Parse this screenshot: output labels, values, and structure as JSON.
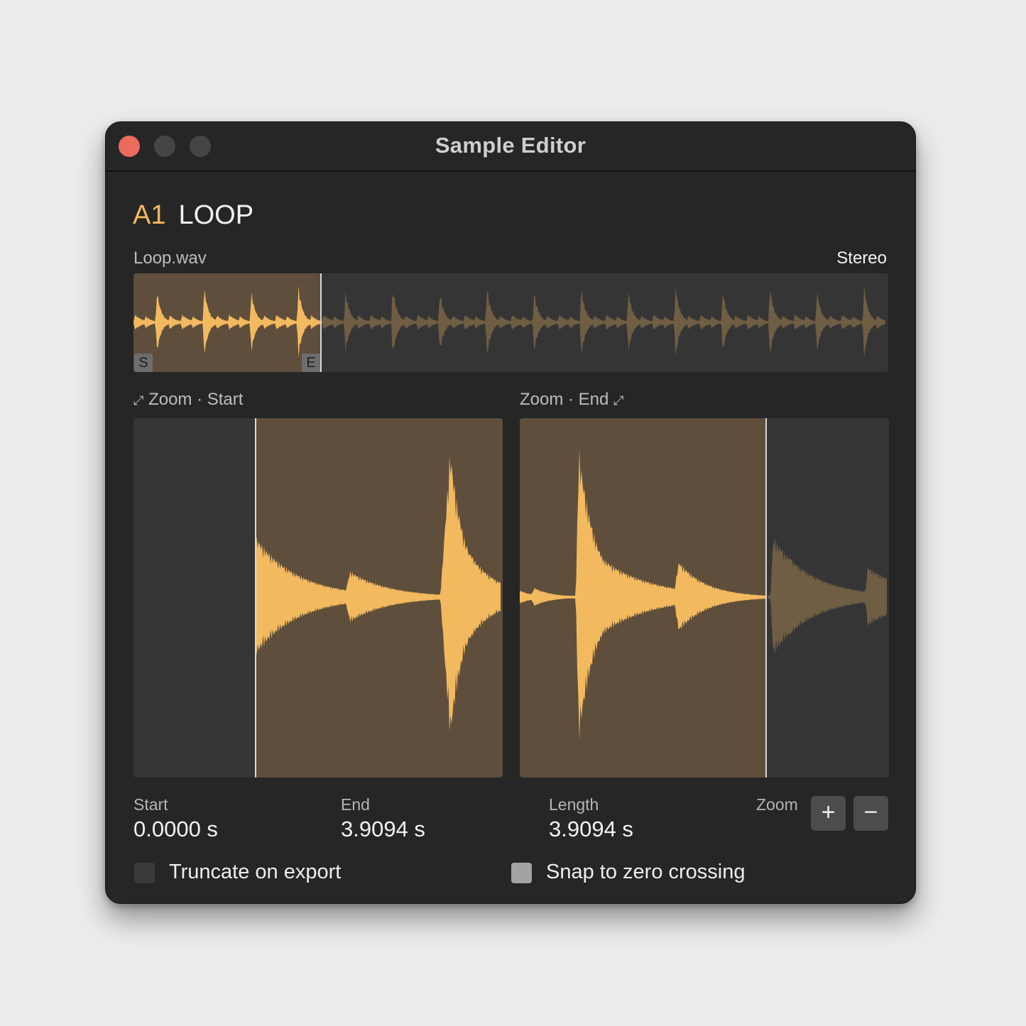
{
  "window": {
    "title": "Sample Editor"
  },
  "sample": {
    "slot": "A1",
    "name": "LOOP",
    "file": "Loop.wav",
    "channels": "Stereo"
  },
  "overview": {
    "start_marker": "S",
    "end_marker": "E",
    "selection_end_fraction": 0.25
  },
  "zoom_start": {
    "icon": "⤢",
    "label": "Zoom · Start"
  },
  "zoom_end": {
    "icon": "⤢",
    "label": "Zoom · End"
  },
  "stats": {
    "start_label": "Start",
    "start_value": "0.0000 s",
    "end_label": "End",
    "end_value": "3.9094 s",
    "length_label": "Length",
    "length_value": "3.9094 s",
    "zoom_label": "Zoom",
    "zoom_in": "+",
    "zoom_out": "−"
  },
  "options": {
    "truncate_label": "Truncate on export",
    "truncate_checked": false,
    "snap_label": "Snap to zero crossing",
    "snap_checked": true
  },
  "colors": {
    "accent": "#f3b95f",
    "accent_dim": "#5e4e3b",
    "wave_dim": "#6f5d44",
    "panel_bg": "#353535",
    "window_bg": "#262626"
  }
}
